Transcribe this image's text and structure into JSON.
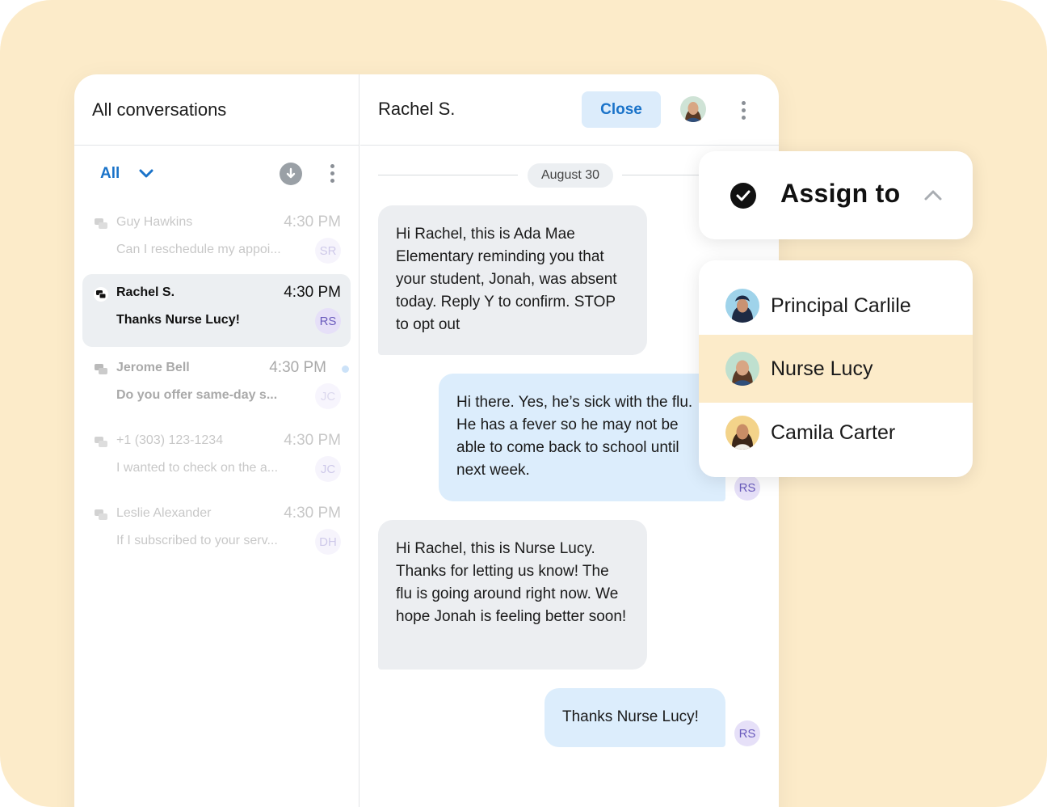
{
  "left_pane": {
    "title": "All conversations",
    "filter_label": "All",
    "conversations": [
      {
        "name": "Guy Hawkins",
        "time": "4:30 PM",
        "preview": "Can I reschedule my appoi...",
        "initials": "SR"
      },
      {
        "name": "Rachel S.",
        "time": "4:30 PM",
        "preview": "Thanks Nurse Lucy!",
        "initials": "RS"
      },
      {
        "name": "Jerome Bell",
        "time": "4:30 PM",
        "preview": "Do you offer same-day s...",
        "initials": "JC"
      },
      {
        "name": "+1 (303) 123-1234",
        "time": "4:30 PM",
        "preview": "I wanted to check on the a...",
        "initials": "JC"
      },
      {
        "name": "Leslie Alexander",
        "time": "4:30 PM",
        "preview": "If I subscribed to your serv...",
        "initials": "DH"
      }
    ]
  },
  "chat": {
    "contact_name": "Rachel S.",
    "close_label": "Close",
    "date_label": "August 30",
    "messages": [
      {
        "direction": "in",
        "text": "Hi Rachel, this is Ada Mae Elementary reminding you that your student, Jonah, was absent today. Reply Y to confirm. STOP to opt out"
      },
      {
        "direction": "out",
        "text": "Hi there. Yes, he’s sick with the flu. He has a fever so he may not be able to come back to school until next week.",
        "initials": "RS"
      },
      {
        "direction": "in",
        "text": "Hi Rachel, this is Nurse Lucy. Thanks for letting us know! The flu is going around right now. We hope Jonah is feeling better soon!"
      },
      {
        "direction": "out",
        "text": "Thanks Nurse Lucy!",
        "initials": "RS"
      }
    ]
  },
  "assign": {
    "label": "Assign to",
    "people": [
      {
        "name": "Principal Carlile",
        "selected": false
      },
      {
        "name": "Nurse Lucy",
        "selected": true
      },
      {
        "name": "Camila Carter",
        "selected": false
      }
    ]
  },
  "colors": {
    "background": "#fcebc9",
    "accent_blue": "#1a73c9",
    "incoming_bubble": "#eceef1",
    "outgoing_bubble": "#dcedfc",
    "selected_row": "#fcebc9"
  },
  "icons": {
    "filter_chevron": "chevron-down-icon",
    "download": "download-icon",
    "menu": "kebab-menu-icon",
    "conversation": "chat-bubbles-icon",
    "assign_check": "check-circle-icon",
    "assign_toggle": "chevron-up-icon"
  }
}
